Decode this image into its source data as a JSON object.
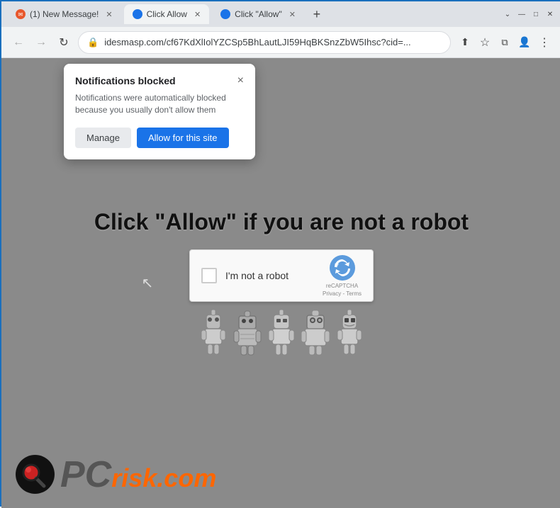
{
  "browser": {
    "title_bar": {
      "tabs": [
        {
          "id": "tab1",
          "title": "(1) New Message!",
          "active": false,
          "favicon_type": "envelope"
        },
        {
          "id": "tab2",
          "title": "Click Allow",
          "active": true,
          "favicon_type": "blue"
        },
        {
          "id": "tab3",
          "title": "Click \"Allow\"",
          "active": false,
          "favicon_type": "blue"
        }
      ],
      "new_tab_label": "+",
      "window_controls": {
        "minimize": "—",
        "maximize": "□",
        "close": "✕"
      }
    },
    "nav_bar": {
      "back_icon": "←",
      "forward_icon": "→",
      "reload_icon": "↻",
      "lock_icon": "🔒",
      "url": "idesmasp.com/cf67KdXlIolYZCSp5BhLautLJI59HqBKSnzZbW5Ihsc?cid=...",
      "bookmark_icon": "☆",
      "menu_icon": "⋮"
    }
  },
  "notification_popup": {
    "title": "Notifications blocked",
    "close_icon": "×",
    "body_text": "Notifications were automatically blocked because you usually don't allow them",
    "manage_label": "Manage",
    "allow_label": "Allow for this site"
  },
  "page": {
    "main_text": "Click \"Allow\"   if you are not   a robot",
    "captcha": {
      "checkbox_label": "I'm not a robot",
      "brand": "reCAPTCHA",
      "privacy": "Privacy",
      "terms": "Terms"
    },
    "pcrisk": {
      "pc_text": "PC",
      "risk_text": "risk.com"
    }
  },
  "colors": {
    "allow_button_bg": "#1a73e8",
    "manage_button_bg": "#e8eaed",
    "page_bg": "#8a8a8a",
    "browser_bg": "#dee1e6",
    "active_tab_bg": "#f1f3f4",
    "pcrisk_orange": "#ff6600",
    "pcrisk_gray": "#555"
  }
}
